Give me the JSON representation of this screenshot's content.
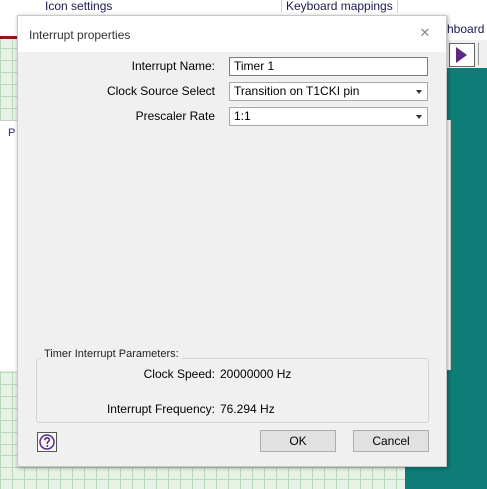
{
  "background": {
    "tabs": [
      "Icon settings",
      "Keyboard mappings"
    ],
    "right_panel_title": "hboard",
    "left_panel_label": "P"
  },
  "dialog": {
    "title": "Interrupt properties",
    "close_glyph": "✕",
    "fields": [
      {
        "label": "Interrupt Name:",
        "value": "Timer 1",
        "type": "text"
      },
      {
        "label": "Clock Source Select",
        "value": "Transition on T1CKI pin",
        "type": "select"
      },
      {
        "label": "Prescaler Rate",
        "value": "1:1",
        "type": "select"
      }
    ],
    "parameters": {
      "legend": "Timer Interrupt Parameters:",
      "clock_speed_label": "Clock Speed:",
      "clock_speed_value": "20000000 Hz",
      "interrupt_frequency_label": "Interrupt Frequency:",
      "interrupt_frequency_value": "76.294 Hz"
    },
    "buttons": {
      "ok": "OK",
      "cancel": "Cancel"
    },
    "help_icon": "help-icon"
  },
  "colors": {
    "teal": "#0e7d78",
    "play_accent": "#5a2a80",
    "grid": "#e8f3e8"
  }
}
